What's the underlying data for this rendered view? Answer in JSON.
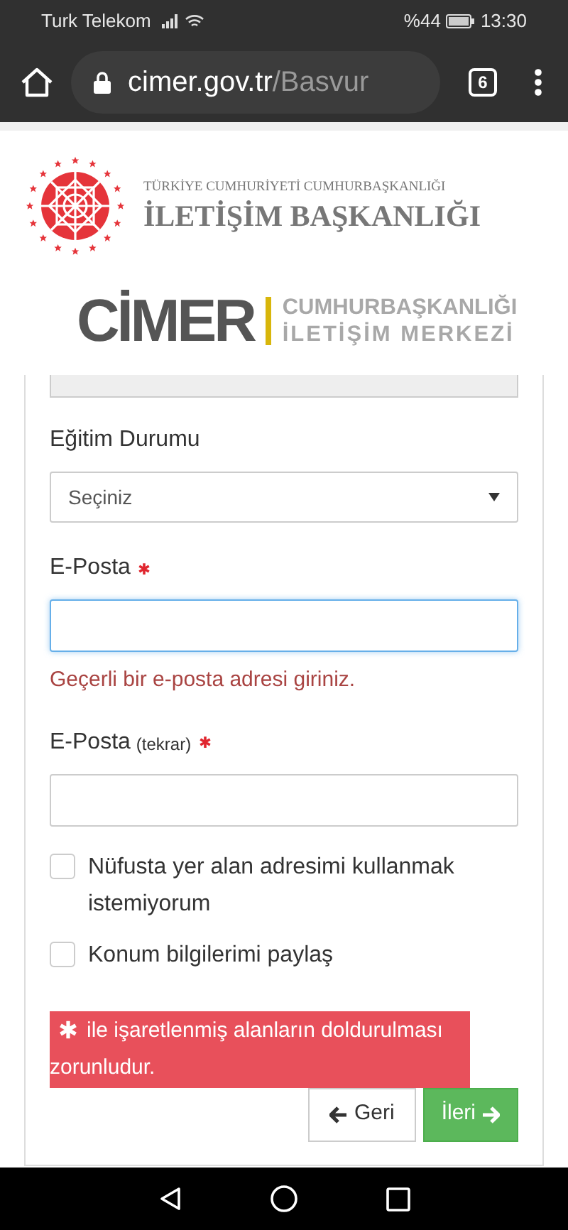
{
  "status_bar": {
    "carrier": "Turk Telekom",
    "battery": "%44",
    "time": "13:30"
  },
  "browser": {
    "url_host": "cimer.gov.tr",
    "url_path": "/Basvur",
    "tab_count": "6"
  },
  "header": {
    "org_top": "TÜRKİYE CUMHURİYETİ CUMHURBAŞKANLIĞI",
    "org_name": "İLETİŞİM BAŞKANLIĞI",
    "brand": "CİMER",
    "brand_line1": "CUMHURBAŞKANLIĞI",
    "brand_line2": "İLETİŞİM MERKEZİ"
  },
  "form": {
    "fields": [
      {
        "kind": "select",
        "label": "Eğitim Durumu",
        "value": "Seçiniz",
        "required": false
      },
      {
        "kind": "input",
        "label": "E-Posta",
        "required": true,
        "focused": true,
        "error": "Geçerli bir e-posta adresi giriniz."
      },
      {
        "kind": "input",
        "label": "E-Posta",
        "note": "(tekrar)",
        "required": true,
        "focused": false
      }
    ],
    "checkboxes": [
      {
        "label": "Nüfusta yer alan adresimi kullanmak istemiyorum",
        "checked": false
      },
      {
        "label": "Konum bilgilerimi paylaş",
        "checked": false
      }
    ],
    "alert": "ile işaretlenmiş alanların doldurulması zorunludur.",
    "buttons": [
      {
        "kind": "back",
        "label": "Geri"
      },
      {
        "kind": "next",
        "label": "İleri"
      }
    ]
  }
}
